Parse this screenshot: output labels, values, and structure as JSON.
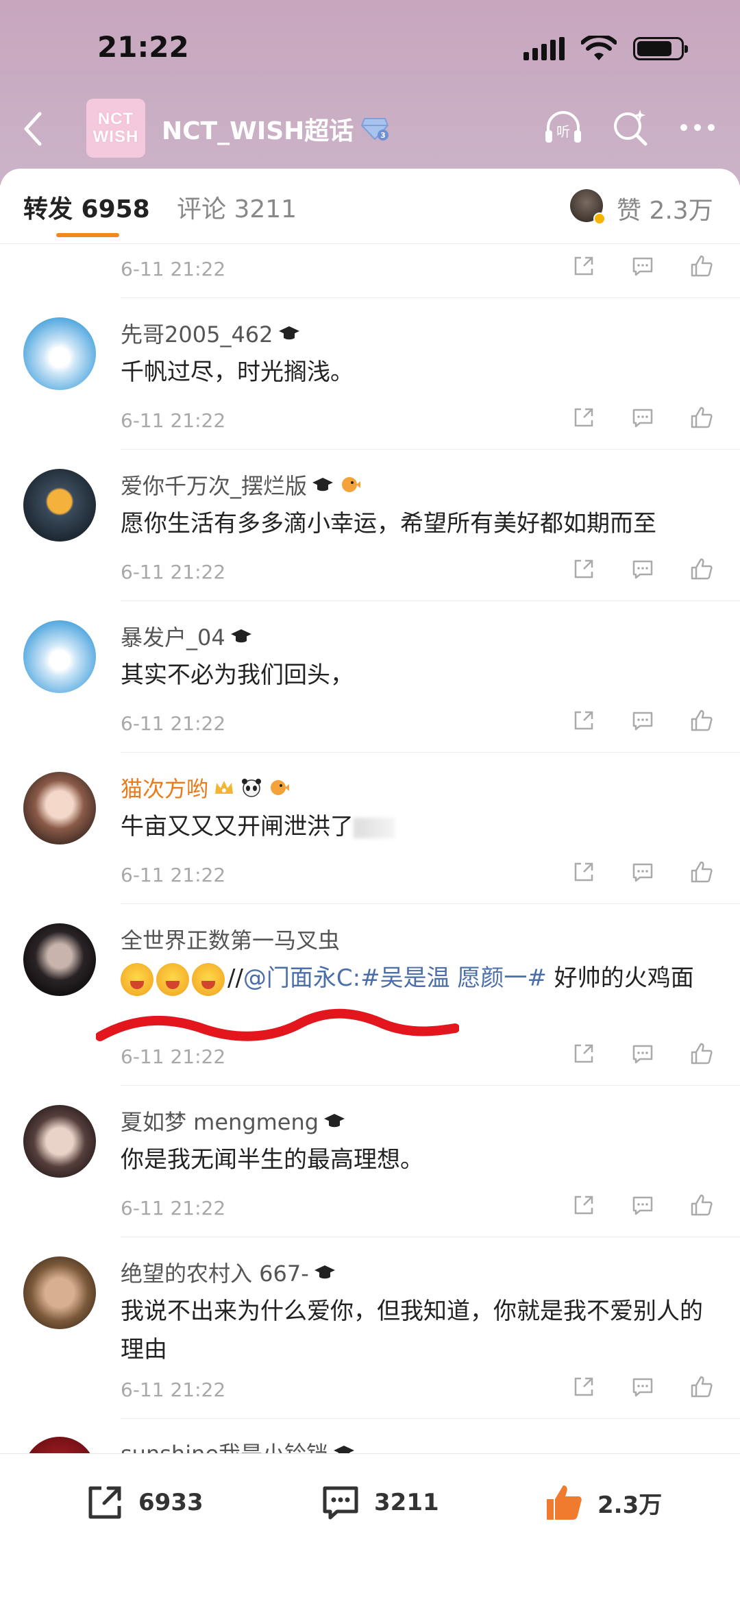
{
  "status_bar": {
    "time": "21:22"
  },
  "header": {
    "topic_logo_line1": "NCT",
    "topic_logo_line2": "WISH",
    "topic_title": "NCT_WISH超话",
    "gem_level": "3"
  },
  "tabs": {
    "repost_label": "转发 6958",
    "comment_label": "评论 3211",
    "likes_label": "赞 2.3万"
  },
  "first_meta_time": "6-11 21:22",
  "comments": [
    {
      "name": "先哥2005_462",
      "text": "千帆过尽，时光搁浅。",
      "time": "6-11 21:22"
    },
    {
      "name": "爱你千万次_摆烂版",
      "text": "愿你生活有多多滴小幸运，希望所有美好都如期而至",
      "time": "6-11 21:22"
    },
    {
      "name": "暴发户_04",
      "text": "其实不必为我们回头，",
      "time": "6-11 21:22"
    },
    {
      "name": "猫次方哟",
      "text": "牛亩又又又开闸泄洪了",
      "time": "6-11 21:22"
    },
    {
      "name": "全世界正数第一马叉虫",
      "text_prefix": "//",
      "mention": "@门面永C:#吴是温 愿颜一#",
      "text_suffix": " 好帅的火鸡面",
      "time": "6-11 21:22"
    },
    {
      "name": "夏如梦 mengmeng",
      "text": "你是我无闻半生的最高理想。",
      "time": "6-11 21:22"
    },
    {
      "name": "绝望的农村入 667-",
      "text": "我说不出来为什么爱你，但我知道，你就是我不爱别人的理由",
      "time": "6-11 21:22"
    },
    {
      "name": "sunshine我是小铃铛"
    }
  ],
  "bottom_bar": {
    "repost_count": "6933",
    "comment_count": "3211",
    "like_count": "2.3万"
  },
  "colors": {
    "header_bg": "#c9aec4",
    "accent_orange": "#f08a1d",
    "link_blue": "#4a6ea9",
    "vip_name": "#e87c1c"
  }
}
